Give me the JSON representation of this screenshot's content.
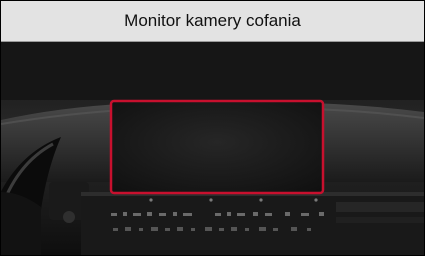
{
  "header": {
    "title": "Monitor kamery cofania"
  },
  "image": {
    "icon": "car-dashboard-photo",
    "highlight_color": "#c8102e"
  },
  "colors": {
    "header_background": "#e3e3e3",
    "photo_background": "#1d1d1d",
    "screen_fill": "#141414"
  }
}
